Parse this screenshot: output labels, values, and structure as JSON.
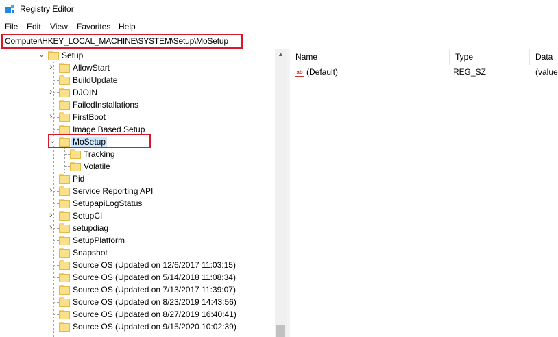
{
  "window": {
    "title": "Registry Editor"
  },
  "menu": [
    "File",
    "Edit",
    "View",
    "Favorites",
    "Help"
  ],
  "address": {
    "path": "Computer\\HKEY_LOCAL_MACHINE\\SYSTEM\\Setup\\MoSetup"
  },
  "tree": {
    "parent": "Setup",
    "items": [
      {
        "label": "AllowStart",
        "expander": "collapsed"
      },
      {
        "label": "BuildUpdate",
        "expander": "none"
      },
      {
        "label": "DJOIN",
        "expander": "collapsed"
      },
      {
        "label": "FailedInstallations",
        "expander": "none"
      },
      {
        "label": "FirstBoot",
        "expander": "collapsed"
      },
      {
        "label": "Image Based Setup",
        "expander": "none"
      },
      {
        "label": "MoSetup",
        "expander": "expanded",
        "selected": true
      },
      {
        "label": "Tracking",
        "expander": "none",
        "child": true
      },
      {
        "label": "Volatile",
        "expander": "none",
        "child": true
      },
      {
        "label": "Pid",
        "expander": "none"
      },
      {
        "label": "Service Reporting API",
        "expander": "collapsed"
      },
      {
        "label": "SetupapiLogStatus",
        "expander": "none"
      },
      {
        "label": "SetupCI",
        "expander": "collapsed"
      },
      {
        "label": "setupdiag",
        "expander": "collapsed"
      },
      {
        "label": "SetupPlatform",
        "expander": "none"
      },
      {
        "label": "Snapshot",
        "expander": "none"
      },
      {
        "label": "Source OS (Updated on 12/6/2017 11:03:15)",
        "expander": "none"
      },
      {
        "label": "Source OS (Updated on 5/14/2018 11:08:34)",
        "expander": "none"
      },
      {
        "label": "Source OS (Updated on 7/13/2017 11:39:07)",
        "expander": "none"
      },
      {
        "label": "Source OS (Updated on 8/23/2019 14:43:56)",
        "expander": "none"
      },
      {
        "label": "Source OS (Updated on 8/27/2019 16:40:41)",
        "expander": "none"
      },
      {
        "label": "Source OS (Updated on 9/15/2020 10:02:39)",
        "expander": "none"
      }
    ]
  },
  "list": {
    "columns": [
      "Name",
      "Type",
      "Data"
    ],
    "rows": [
      {
        "name": "(Default)",
        "type": "REG_SZ",
        "data": "(value"
      }
    ]
  },
  "colors": {
    "highlight": "#d7192a",
    "selection": "#cce8ff",
    "folder": "#fbe08a"
  }
}
